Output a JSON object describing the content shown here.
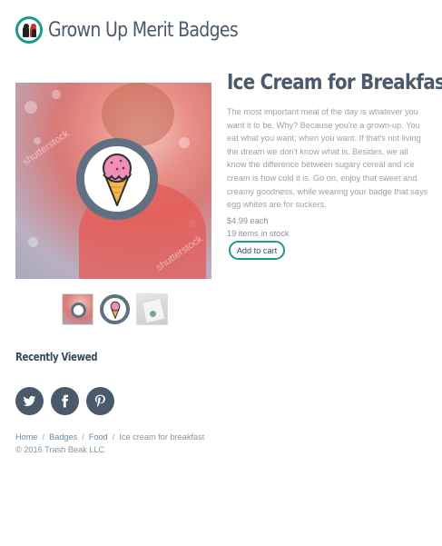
{
  "header": {
    "site_title": "Grown Up Merit Badges"
  },
  "product": {
    "title": "Ice Cream for Breakfast",
    "description": "The most important meal of the day is whatever you want it to be. Why? Because you're a grown-up. You eat what you want, when you want. If that's not living the dream we don't know what is. Besides, we all know the difference between sugary cereal and ice cream is how cold it is. Go on, enjoy that sweet and creamy goodness, while wearing your badge that says egg whites are for suckers.",
    "price": "$4.99 each",
    "stock": "19 items in stock",
    "add_to_cart_label": "Add to cart",
    "main_image_icon": "ice-cream-cone-icon",
    "watermark": "shutterstock",
    "thumbnails": [
      "lifestyle-photo-thumbnail",
      "badge-thumbnail",
      "package-thumbnail"
    ]
  },
  "recently_viewed": {
    "heading": "Recently Viewed"
  },
  "social": [
    {
      "name": "twitter-icon"
    },
    {
      "name": "facebook-icon"
    },
    {
      "name": "pinterest-icon"
    }
  ],
  "breadcrumb": {
    "items": [
      "Home",
      "Badges",
      "Food"
    ],
    "current": "Ice cream for breakfast",
    "separator": "/"
  },
  "footer": {
    "copyright": "© 2016 Trash Beak LLC"
  },
  "colors": {
    "accent": "#1a9b8a",
    "text": "#4a5a6a",
    "muted": "#9aa3ab",
    "badge_ring": "#5f7080"
  }
}
